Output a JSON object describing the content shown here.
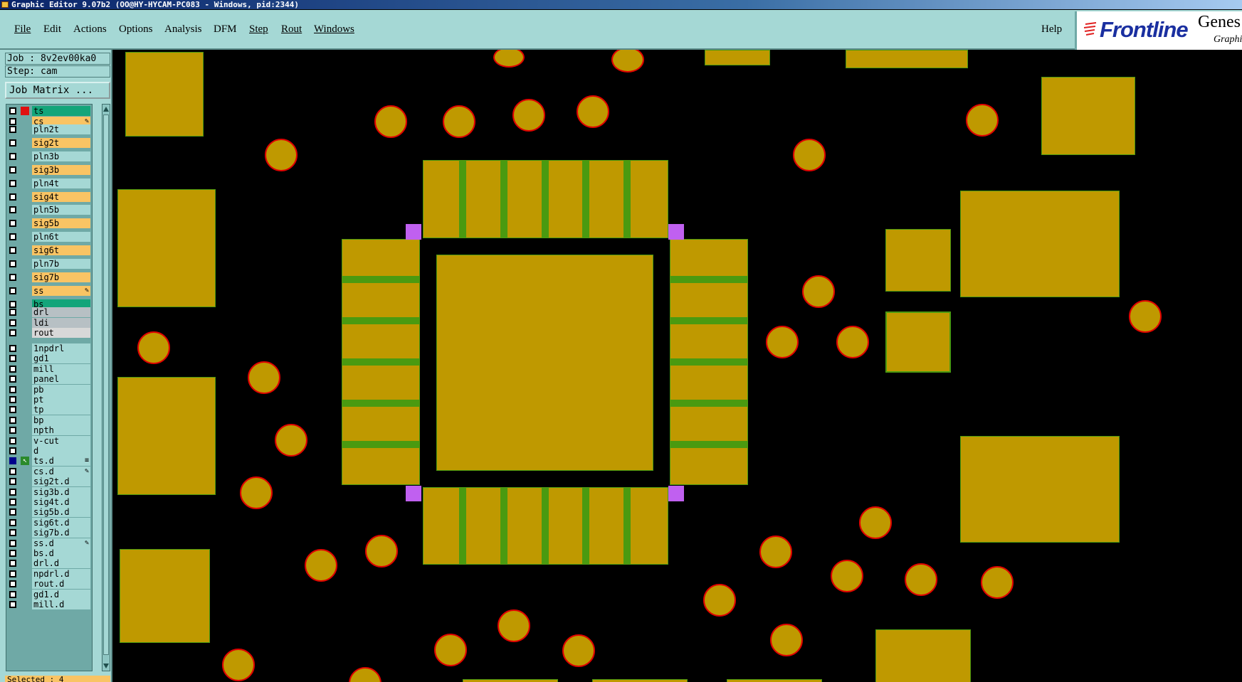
{
  "window": {
    "title": "Graphic Editor 9.07b2 (OO@HY-HYCAM-PC083 - Windows, pid:2344)"
  },
  "menubar": {
    "items": [
      {
        "label": "File"
      },
      {
        "label": "Edit"
      },
      {
        "label": "Actions"
      },
      {
        "label": "Options"
      },
      {
        "label": "Analysis"
      },
      {
        "label": "DFM"
      },
      {
        "label": "Step"
      },
      {
        "label": "Rout"
      },
      {
        "label": "Windows"
      },
      {
        "label": "Help"
      }
    ]
  },
  "logo": {
    "brand": "Frontline",
    "product": "Genes",
    "subtitle": "Graphi"
  },
  "info": {
    "job": "Job : 8v2ev00ka0",
    "step": "Step: cam",
    "job_matrix_button": "Job Matrix ..."
  },
  "colors": {
    "board_color": "#e6b800",
    "signal_layer": "#f9c464",
    "outer_layer": "#13a57a",
    "drill_layer": "#b7c0c4",
    "misc_layer": "#a5d8d5",
    "pad_fill": "#bf9900",
    "via_outline": "#e00000",
    "trace_green": "#4a9a10",
    "marker_purple": "#c060f0"
  },
  "layers": [
    {
      "name": "ts",
      "color": "#13a57a",
      "swatch": "#e01010",
      "mark": ""
    },
    {
      "name": "cs",
      "color": "#f9c464",
      "swatch": "",
      "mark": "✎"
    },
    {
      "name": "pln2t",
      "color": "#a5d8d5",
      "swatch": "",
      "mark": ""
    },
    {
      "name": "sig2t",
      "color": "#f9c464",
      "swatch": "",
      "mark": ""
    },
    {
      "name": "pln3b",
      "color": "#a5d8d5",
      "swatch": "",
      "mark": ""
    },
    {
      "name": "sig3b",
      "color": "#f9c464",
      "swatch": "",
      "mark": ""
    },
    {
      "name": "pln4t",
      "color": "#a5d8d5",
      "swatch": "",
      "mark": ""
    },
    {
      "name": "sig4t",
      "color": "#f9c464",
      "swatch": "",
      "mark": ""
    },
    {
      "name": "pln5b",
      "color": "#a5d8d5",
      "swatch": "",
      "mark": ""
    },
    {
      "name": "sig5b",
      "color": "#f9c464",
      "swatch": "",
      "mark": ""
    },
    {
      "name": "pln6t",
      "color": "#a5d8d5",
      "swatch": "",
      "mark": ""
    },
    {
      "name": "sig6t",
      "color": "#f9c464",
      "swatch": "",
      "mark": ""
    },
    {
      "name": "pln7b",
      "color": "#a5d8d5",
      "swatch": "",
      "mark": ""
    },
    {
      "name": "sig7b",
      "color": "#f9c464",
      "swatch": "",
      "mark": ""
    },
    {
      "name": "ss",
      "color": "#f9c464",
      "swatch": "",
      "mark": "✎"
    },
    {
      "name": "bs",
      "color": "#13a57a",
      "swatch": "",
      "mark": ""
    },
    {
      "name": "drl",
      "color": "#b7c0c4",
      "swatch": "",
      "mark": ""
    },
    {
      "name": "ldi",
      "color": "#b7c0c4",
      "swatch": "",
      "mark": ""
    },
    {
      "name": "rout",
      "color": "#d8d8d8",
      "swatch": "",
      "mark": ""
    },
    {
      "name": "1npdrl",
      "color": "#a5d8d5",
      "swatch": "",
      "mark": ""
    },
    {
      "name": "gd1",
      "color": "#a5d8d5",
      "swatch": "",
      "mark": ""
    },
    {
      "name": "mill",
      "color": "#a5d8d5",
      "swatch": "",
      "mark": ""
    },
    {
      "name": "panel",
      "color": "#a5d8d5",
      "swatch": "",
      "mark": ""
    },
    {
      "name": "pb",
      "color": "#a5d8d5",
      "swatch": "",
      "mark": ""
    },
    {
      "name": "pt",
      "color": "#a5d8d5",
      "swatch": "",
      "mark": ""
    },
    {
      "name": "tp",
      "color": "#a5d8d5",
      "swatch": "",
      "mark": ""
    },
    {
      "name": "bp",
      "color": "#a5d8d5",
      "swatch": "",
      "mark": ""
    },
    {
      "name": "npth",
      "color": "#a5d8d5",
      "swatch": "",
      "mark": ""
    },
    {
      "name": "v-cut",
      "color": "#a5d8d5",
      "swatch": "",
      "mark": ""
    },
    {
      "name": "d",
      "color": "#a5d8d5",
      "swatch": "",
      "mark": ""
    },
    {
      "name": "ts.d",
      "color": "#a5d8d5",
      "swatch": "#2a8a2a",
      "mark": "≡",
      "active": true
    },
    {
      "name": "cs.d",
      "color": "#a5d8d5",
      "swatch": "",
      "mark": "✎"
    },
    {
      "name": "sig2t.d",
      "color": "#a5d8d5",
      "swatch": "",
      "mark": ""
    },
    {
      "name": "sig3b.d",
      "color": "#a5d8d5",
      "swatch": "",
      "mark": ""
    },
    {
      "name": "sig4t.d",
      "color": "#a5d8d5",
      "swatch": "",
      "mark": ""
    },
    {
      "name": "sig5b.d",
      "color": "#a5d8d5",
      "swatch": "",
      "mark": ""
    },
    {
      "name": "sig6t.d",
      "color": "#a5d8d5",
      "swatch": "",
      "mark": ""
    },
    {
      "name": "sig7b.d",
      "color": "#a5d8d5",
      "swatch": "",
      "mark": ""
    },
    {
      "name": "ss.d",
      "color": "#a5d8d5",
      "swatch": "",
      "mark": "✎"
    },
    {
      "name": "bs.d",
      "color": "#a5d8d5",
      "swatch": "",
      "mark": ""
    },
    {
      "name": "drl.d",
      "color": "#a5d8d5",
      "swatch": "",
      "mark": ""
    },
    {
      "name": "npdrl.d",
      "color": "#a5d8d5",
      "swatch": "",
      "mark": ""
    },
    {
      "name": "rout.d",
      "color": "#a5d8d5",
      "swatch": "",
      "mark": ""
    },
    {
      "name": "gd1.d",
      "color": "#a5d8d5",
      "swatch": "",
      "mark": ""
    },
    {
      "name": "mill.d",
      "color": "#a5d8d5",
      "swatch": "",
      "mark": ""
    }
  ],
  "status": {
    "selected": "Selected : 4"
  }
}
